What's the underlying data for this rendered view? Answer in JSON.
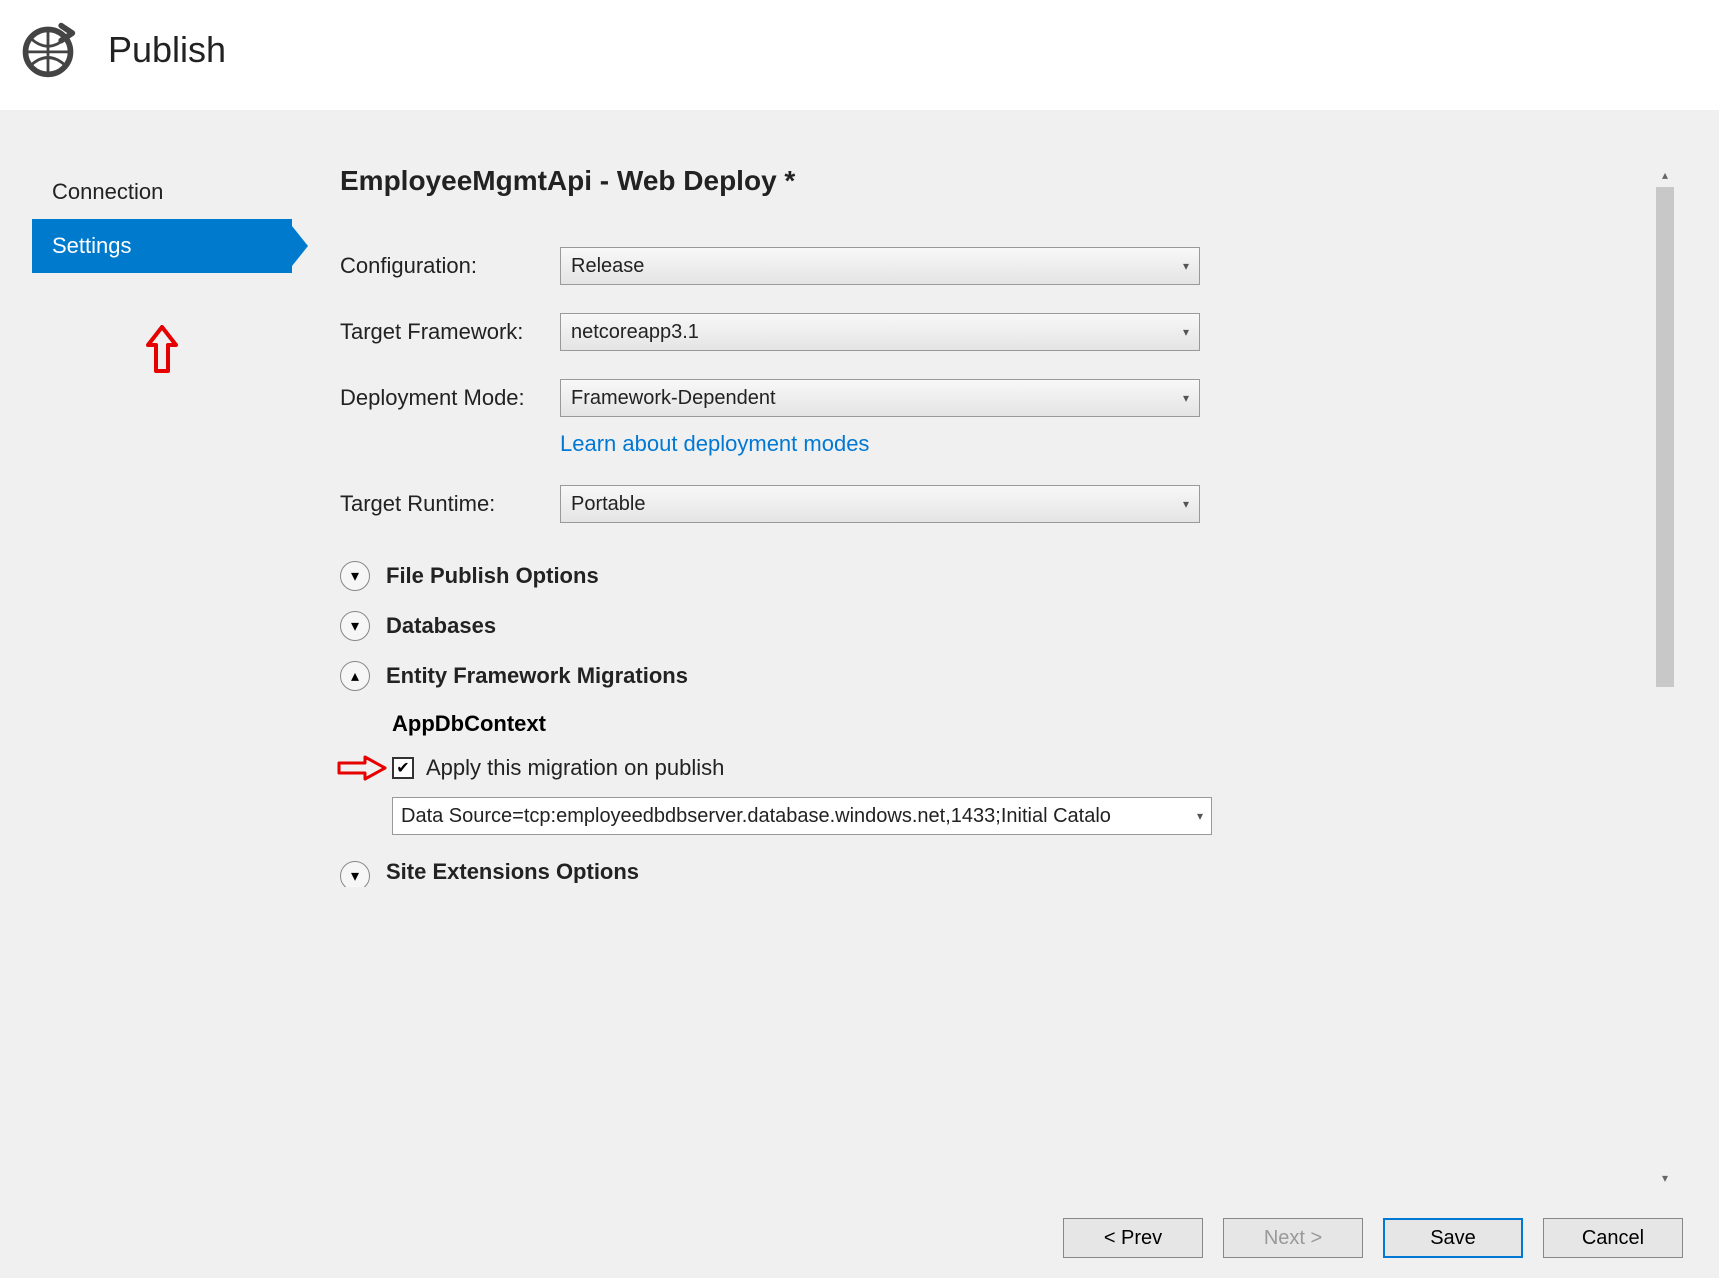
{
  "header": {
    "title": "Publish"
  },
  "sidebar": {
    "items": [
      {
        "label": "Connection",
        "active": false
      },
      {
        "label": "Settings",
        "active": true
      }
    ]
  },
  "main": {
    "title": "EmployeeMgmtApi - Web Deploy *",
    "configuration": {
      "label": "Configuration:",
      "value": "Release"
    },
    "targetFramework": {
      "label": "Target Framework:",
      "value": "netcoreapp3.1"
    },
    "deploymentMode": {
      "label": "Deployment Mode:",
      "value": "Framework-Dependent",
      "learnLink": "Learn about deployment modes"
    },
    "targetRuntime": {
      "label": "Target Runtime:",
      "value": "Portable"
    },
    "sections": {
      "filePublish": {
        "title": "File Publish Options",
        "expanded": false
      },
      "databases": {
        "title": "Databases",
        "expanded": false
      },
      "efMigrations": {
        "title": "Entity Framework Migrations",
        "expanded": true,
        "context": "AppDbContext",
        "applyCheckbox": {
          "checked": true,
          "label": "Apply this migration on publish"
        },
        "connectionString": "Data Source=tcp:employeedbdbserver.database.windows.net,1433;Initial Catalo"
      },
      "siteExtensions": {
        "title": "Site Extensions Options",
        "expanded": false
      }
    }
  },
  "footer": {
    "prev": "<  Prev",
    "next": "Next  >",
    "save": "Save",
    "cancel": "Cancel"
  }
}
